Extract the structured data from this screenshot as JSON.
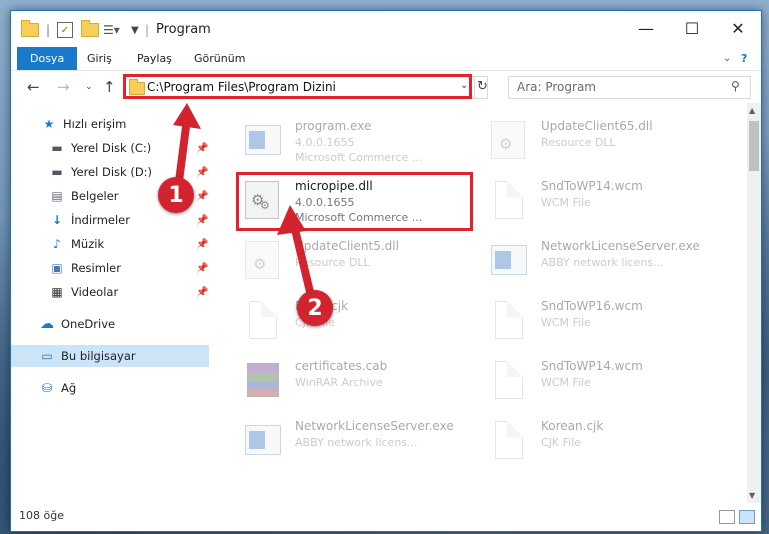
{
  "window": {
    "title": "Program",
    "controls": {
      "minimize": "—",
      "maximize": "☐",
      "close": "✕"
    }
  },
  "ribbon": {
    "tabs": [
      "Dosya",
      "Giriş",
      "Paylaş",
      "Görünüm"
    ],
    "help": "?"
  },
  "address": {
    "path": "C:\\Program Files\\Program Dizini",
    "search_placeholder": "Ara: Program"
  },
  "nav": {
    "quick_access": "Hızlı erişim",
    "items": [
      "Yerel Disk (C:)",
      "Yerel Disk (D:)",
      "Belgeler",
      "İndirmeler",
      "Müzik",
      "Resimler",
      "Videolar"
    ],
    "onedrive": "OneDrive",
    "this_pc": "Bu bilgisayar",
    "network": "Ağ"
  },
  "files": [
    {
      "name": "program.exe",
      "line2": "4.0.0.1655",
      "line3": "Microsoft Commerce ...",
      "icon": "exe-icon"
    },
    {
      "name": "UpdateClient65.dll",
      "line2": "Resource DLL",
      "line3": "",
      "icon": "dll-icon"
    },
    {
      "name": "micropipe.dll",
      "line2": "4.0.0.1655",
      "line3": "Microsoft Commerce ...",
      "icon": "dll-icon"
    },
    {
      "name": "SndToWP14.wcm",
      "line2": "WCM File",
      "line3": "",
      "icon": "file-icon"
    },
    {
      "name": "UpdateClient5.dll",
      "line2": "Resource DLL",
      "line3": "",
      "icon": "dll-icon"
    },
    {
      "name": "NetworkLicenseServer.exe",
      "line2": "ABBY network licens...",
      "line3": "",
      "icon": "exe-icon"
    },
    {
      "name": "Fonts.cjk",
      "line2": "CJK File",
      "line3": "",
      "icon": "file-icon"
    },
    {
      "name": "SndToWP16.wcm",
      "line2": "WCM File",
      "line3": "",
      "icon": "file-icon"
    },
    {
      "name": "certificates.cab",
      "line2": "WinRAR Archive",
      "line3": "",
      "icon": "archive-icon"
    },
    {
      "name": "SndToWP14.wcm",
      "line2": "WCM File",
      "line3": "",
      "icon": "file-icon"
    },
    {
      "name": "NetworkLicenseServer.exe",
      "line2": "ABBY network licens...",
      "line3": "",
      "icon": "exe-icon"
    },
    {
      "name": "Korean.cjk",
      "line2": "CJK File",
      "line3": "",
      "icon": "file-icon"
    }
  ],
  "status": {
    "count": "108 öğe"
  },
  "annotations": {
    "step1": "1",
    "step2": "2"
  },
  "colors": {
    "accent": "#1979ca",
    "highlight": "#e0232e",
    "selected": "#cce4f7"
  }
}
